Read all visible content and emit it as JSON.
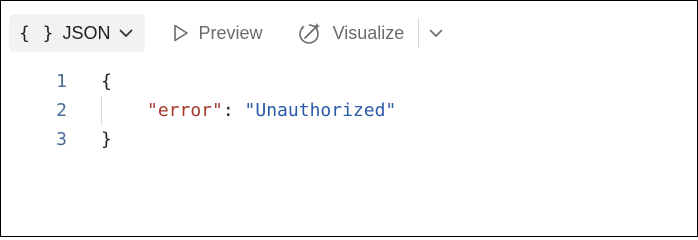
{
  "toolbar": {
    "format_label": "JSON",
    "format_icon": "braces-icon",
    "braces_glyph": "{ }",
    "preview_label": "Preview",
    "visualize_label": "Visualize"
  },
  "code": {
    "lines": [
      {
        "number": "1",
        "open": "{"
      },
      {
        "number": "2",
        "key": "\"error\"",
        "sep": ": ",
        "value": "\"Unauthorized\""
      },
      {
        "number": "3",
        "close": "}"
      }
    ]
  },
  "colors": {
    "key": "#a6372b",
    "string": "#2a5aa8",
    "line_number": "#4a6d96"
  }
}
